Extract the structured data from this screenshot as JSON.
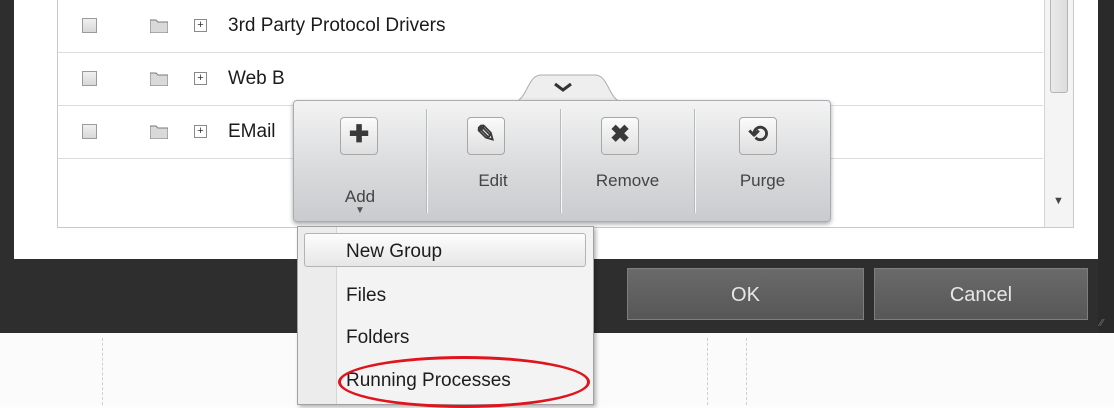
{
  "list": {
    "rows": [
      {
        "label": "3rd Party Protocol Drivers"
      },
      {
        "label": "Web B"
      },
      {
        "label": "EMail"
      }
    ]
  },
  "toolbar": {
    "items": [
      {
        "label": "Add",
        "icon": "plus-icon",
        "glyph": "✚"
      },
      {
        "label": "Edit",
        "icon": "pen-icon",
        "glyph": "✎"
      },
      {
        "label": "Remove",
        "icon": "x-icon",
        "glyph": "✖"
      },
      {
        "label": "Purge",
        "icon": "refresh-icon",
        "glyph": "⟲"
      }
    ]
  },
  "menu": {
    "items": [
      {
        "label": "New Group",
        "highlighted": true
      },
      {
        "label": "Files"
      },
      {
        "label": "Folders"
      },
      {
        "label": "Running Processes",
        "circled": true
      }
    ]
  },
  "buttons": {
    "ok": "OK",
    "cancel": "Cancel"
  },
  "colors": {
    "annotation_circle": "#e0141c",
    "frame": "#2e2e2e",
    "button": "#5f5f5f"
  }
}
